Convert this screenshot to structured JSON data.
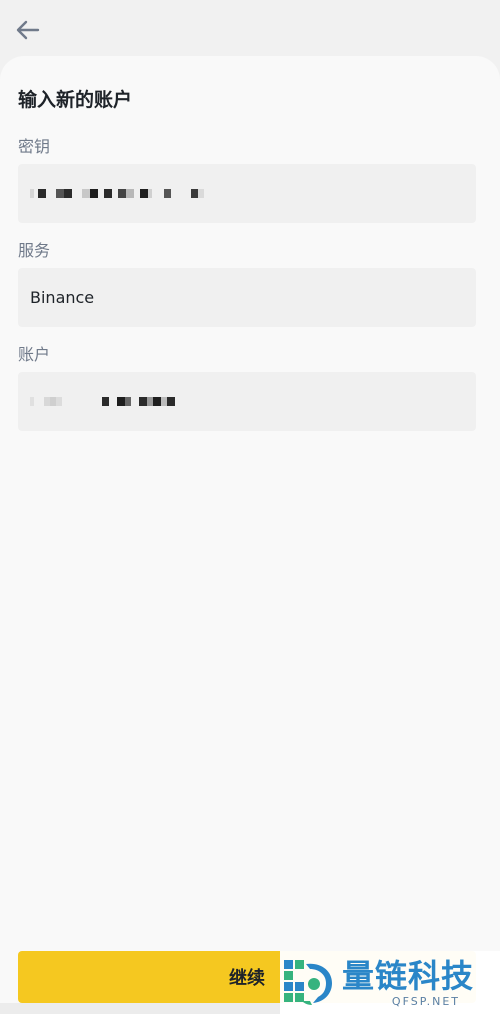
{
  "header": {
    "back_icon": "arrow-left-icon"
  },
  "form": {
    "title": "输入新的账户",
    "secret_key": {
      "label": "密钥",
      "value_masked": true
    },
    "service": {
      "label": "服务",
      "value": "Binance"
    },
    "account": {
      "label": "账户",
      "value_masked": true
    }
  },
  "footer": {
    "continue_label": "继续"
  },
  "watermark": {
    "title": "量链科技",
    "subtitle": "QFSP.NET"
  },
  "colors": {
    "accent": "#f5c820",
    "field_bg": "#f0f0f0",
    "label": "#707a8a",
    "text": "#1e2329"
  }
}
